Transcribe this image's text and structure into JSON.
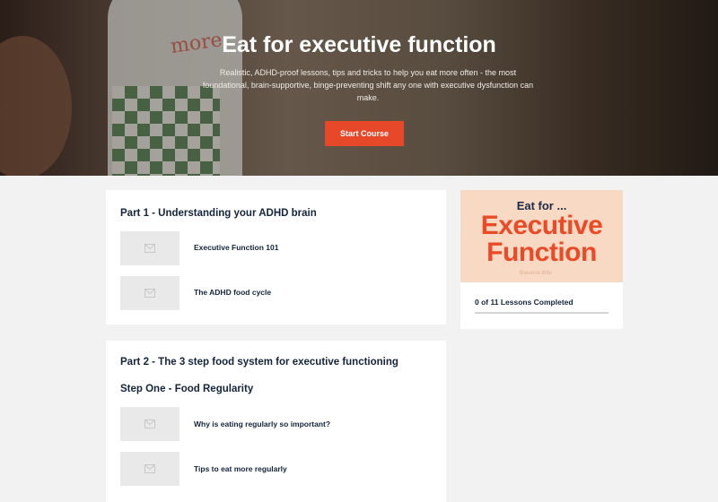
{
  "hero": {
    "title": "Eat for executive function",
    "subtitle": "Realistic, ADHD-proof lessons, tips and tricks to help you eat more often - the most foundational, brain-supportive, binge-preventing shift any one with executive dysfunction can make.",
    "start_button": "Start Course",
    "shirt_text": "more"
  },
  "sections": [
    {
      "title": "Part 1 - Understanding your ADHD brain",
      "lessons": [
        {
          "title": "Executive Function 101",
          "thumb_icon": "envelope-icon"
        },
        {
          "title": "The ADHD food cycle",
          "thumb_icon": "envelope-icon"
        }
      ]
    },
    {
      "title": "Part 2 - The 3 step food system for executive functioning",
      "subtitle": "Step One - Food Regularity",
      "lessons": [
        {
          "title": "Why is eating regularly so important?",
          "thumb_icon": "envelope-icon"
        },
        {
          "title": "Tips to eat more regularly",
          "thumb_icon": "envelope-icon"
        }
      ]
    }
  ],
  "course_card": {
    "cover_line1": "Eat for ...",
    "cover_line2": "Executive",
    "cover_line3": "Function",
    "cover_brand": "Balance Bite",
    "progress_text": "0 of 11 Lessons Completed",
    "progress_completed": 0,
    "progress_total": 11
  },
  "colors": {
    "accent": "#e8482a",
    "heading": "#14243c",
    "cover_bg": "#f8d9c4",
    "cover_text": "#ea4a26"
  }
}
